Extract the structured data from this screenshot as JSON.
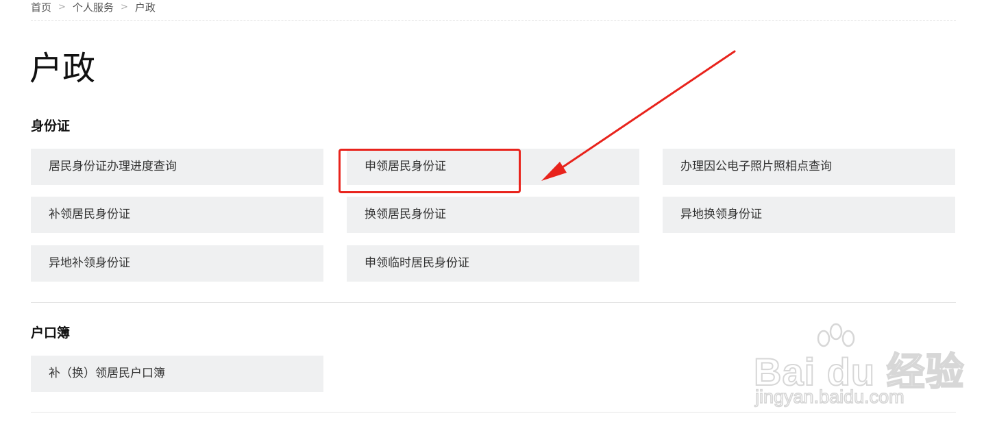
{
  "breadcrumb": {
    "home": "首页",
    "personal": "个人服务",
    "current": "户政",
    "separator": ">"
  },
  "page_title": "户政",
  "sections": {
    "id_card": {
      "title": "身份证",
      "items": [
        "居民身份证办理进度查询",
        "申领居民身份证",
        "办理因公电子照片照相点查询",
        "补领居民身份证",
        "换领居民身份证",
        "异地换领身份证",
        "异地补领身份证",
        "申领临时居民身份证"
      ]
    },
    "household": {
      "title": "户口簿",
      "items": [
        "补（换）领居民户口簿"
      ]
    }
  },
  "annotation": {
    "color": "#e8231c",
    "highlighted_item": "申领居民身份证"
  },
  "watermark": {
    "main": "Bai du 经验",
    "sub": "jingyan.baidu.com"
  },
  "colors": {
    "tile_bg": "#eff0f1",
    "text": "#333333",
    "annotation": "#e8231c"
  }
}
